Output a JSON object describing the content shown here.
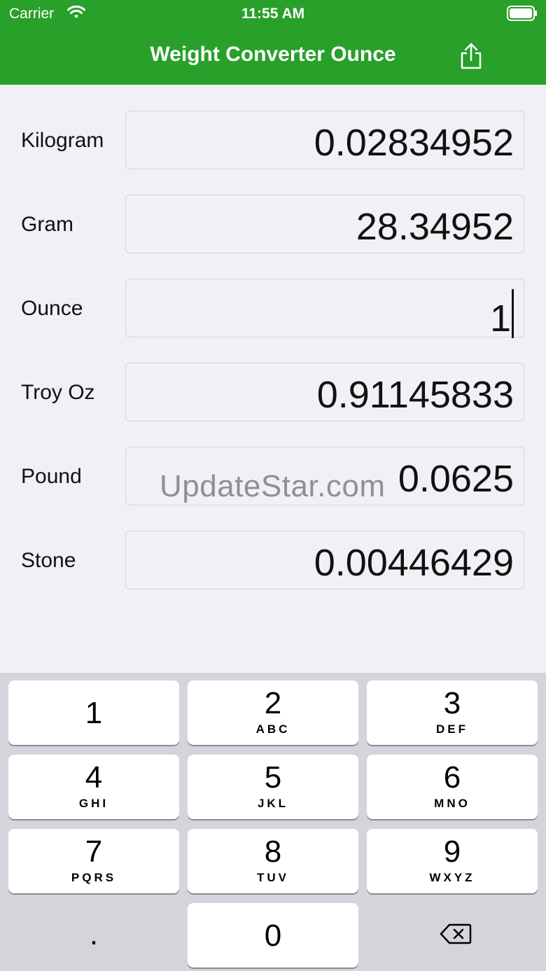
{
  "status_bar": {
    "carrier": "Carrier",
    "time": "11:55 AM"
  },
  "nav": {
    "title": "Weight Converter Ounce"
  },
  "rows": [
    {
      "label": "Kilogram",
      "value": "0.02834952"
    },
    {
      "label": "Gram",
      "value": "28.34952"
    },
    {
      "label": "Ounce",
      "value": "1"
    },
    {
      "label": "Troy Oz",
      "value": "0.91145833"
    },
    {
      "label": "Pound",
      "value": "0.0625"
    },
    {
      "label": "Stone",
      "value": "0.00446429"
    }
  ],
  "watermark": "UpdateStar.com",
  "keyboard": {
    "keys": [
      {
        "digit": "1",
        "letters": ""
      },
      {
        "digit": "2",
        "letters": "ABC"
      },
      {
        "digit": "3",
        "letters": "DEF"
      },
      {
        "digit": "4",
        "letters": "GHI"
      },
      {
        "digit": "5",
        "letters": "JKL"
      },
      {
        "digit": "6",
        "letters": "MNO"
      },
      {
        "digit": "7",
        "letters": "PQRS"
      },
      {
        "digit": "8",
        "letters": "TUV"
      },
      {
        "digit": "9",
        "letters": "WXYZ"
      }
    ],
    "dot": ".",
    "zero": "0"
  },
  "icons": {
    "wifi": "wifi-icon",
    "battery": "battery-icon",
    "share": "share-icon",
    "delete": "backspace-icon"
  },
  "colors": {
    "nav_green": "#28a02a",
    "background": "#f0f1f5",
    "keyboard": "#d3d5db"
  }
}
